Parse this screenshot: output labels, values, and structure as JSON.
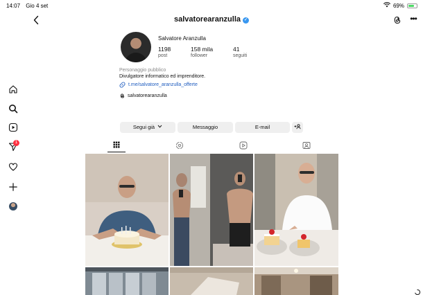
{
  "status_bar": {
    "time": "14:07",
    "date": "Gio 4 set",
    "battery": "69%",
    "battery_level": 0.69
  },
  "header": {
    "username": "salvatorearanzulla",
    "verified_icon": "verified-badge-icon"
  },
  "sidebar": {
    "notification_count": "1",
    "icons": [
      "home-icon",
      "search-icon",
      "reels-icon",
      "messenger-icon",
      "heart-icon",
      "plus-icon",
      "profile-avatar"
    ]
  },
  "profile": {
    "full_name": "Salvatore Aranzulla",
    "stats": [
      {
        "value": "1198",
        "label": "post"
      },
      {
        "value": "158 mila",
        "label": "follower"
      },
      {
        "value": "41",
        "label": "seguiti"
      }
    ],
    "category": "Personaggio pubblico",
    "bio": "Divulgatore informatico ed imprenditore.",
    "link": "t.me/salvatore_aranzulla_offerte",
    "threads_handle": "salvatorearanzulla"
  },
  "actions": {
    "follow_label": "Segui già",
    "message_label": "Messaggio",
    "email_label": "E-mail",
    "suggest_icon": "add-person-icon"
  },
  "tabs": [
    "grid-icon",
    "collab-icon",
    "reels-tab-icon",
    "tagged-icon"
  ],
  "colors": {
    "accent_link": "#1d5bbf",
    "verified": "#3897f0",
    "badge": "#ff3040",
    "button_bg": "#efefef"
  }
}
